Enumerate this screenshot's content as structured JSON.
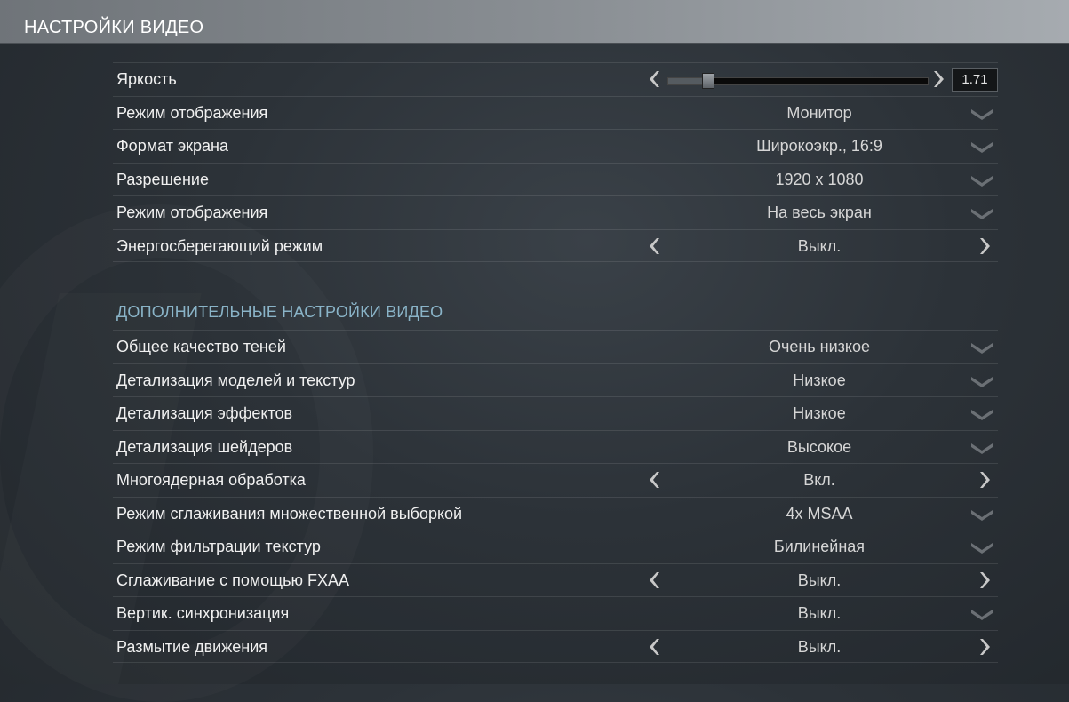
{
  "header": {
    "title": "НАСТРОЙКИ ВИДЕО"
  },
  "brightness": {
    "label": "Яркость",
    "value": "1.71",
    "fraction": 0.13
  },
  "basic_rows": [
    {
      "label": "Режим отображения",
      "value": "Монитор",
      "control": "dropdown"
    },
    {
      "label": "Формат экрана",
      "value": "Широкоэкр., 16:9",
      "control": "dropdown"
    },
    {
      "label": "Разрешение",
      "value": "1920 x 1080",
      "control": "dropdown"
    },
    {
      "label": "Режим отображения",
      "value": "На весь экран",
      "control": "dropdown"
    },
    {
      "label": "Энергосберегающий режим",
      "value": "Выкл.",
      "control": "toggle"
    }
  ],
  "advanced": {
    "title": "ДОПОЛНИТЕЛЬНЫЕ НАСТРОЙКИ ВИДЕО",
    "rows": [
      {
        "label": "Общее качество теней",
        "value": "Очень низкое",
        "control": "dropdown"
      },
      {
        "label": "Детализация моделей и текстур",
        "value": "Низкое",
        "control": "dropdown"
      },
      {
        "label": "Детализация эффектов",
        "value": "Низкое",
        "control": "dropdown"
      },
      {
        "label": "Детализация шейдеров",
        "value": "Высокое",
        "control": "dropdown"
      },
      {
        "label": "Многоядерная обработка",
        "value": "Вкл.",
        "control": "toggle"
      },
      {
        "label": "Режим сглаживания множественной выборкой",
        "value": "4x MSAA",
        "control": "dropdown"
      },
      {
        "label": "Режим фильтрации текстур",
        "value": "Билинейная",
        "control": "dropdown"
      },
      {
        "label": "Сглаживание с помощью FXAA",
        "value": "Выкл.",
        "control": "toggle"
      },
      {
        "label": "Вертик. синхронизация",
        "value": "Выкл.",
        "control": "dropdown"
      },
      {
        "label": "Размытие движения",
        "value": "Выкл.",
        "control": "toggle"
      }
    ]
  },
  "icons": {
    "dropdown": "chevron-down-icon",
    "left": "arrow-left-icon",
    "right": "arrow-right-icon"
  },
  "colors": {
    "accent": "#8ab4c8",
    "text": "#f0f0f0",
    "value": "#d6d6d6"
  }
}
